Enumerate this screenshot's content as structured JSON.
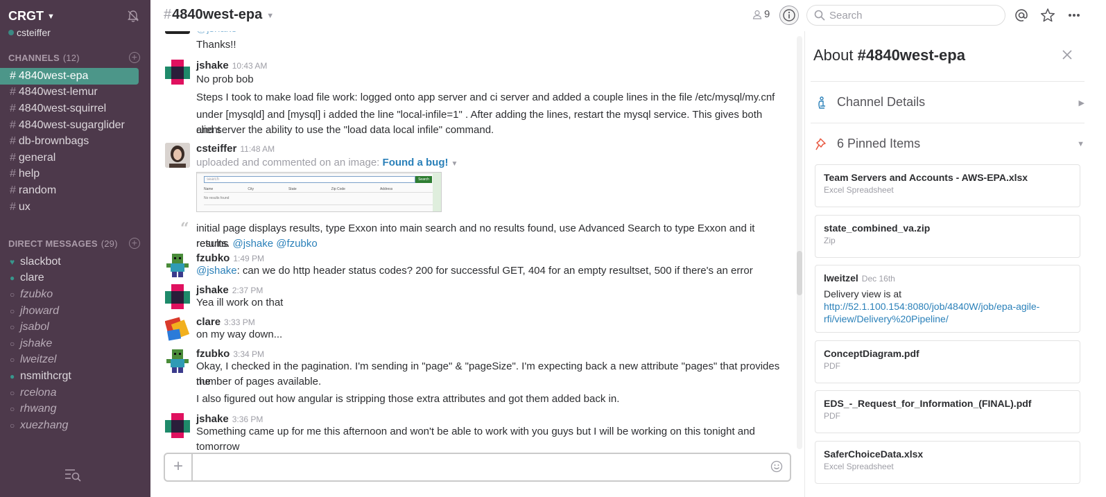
{
  "team": {
    "name": "CRGT",
    "user": "csteiffer"
  },
  "sidebar": {
    "channels_header": "CHANNELS",
    "channels_count": "(12)",
    "channels": [
      {
        "name": "4840west-epa"
      },
      {
        "name": "4840west-lemur"
      },
      {
        "name": "4840west-squirrel"
      },
      {
        "name": "4840west-sugarglider"
      },
      {
        "name": "db-brownbags"
      },
      {
        "name": "general"
      },
      {
        "name": "help"
      },
      {
        "name": "random"
      },
      {
        "name": "ux"
      }
    ],
    "dm_header": "DIRECT MESSAGES",
    "dm_count": "(29)",
    "dms": [
      {
        "name": "slackbot",
        "status": "heart"
      },
      {
        "name": "clare",
        "status": "online"
      },
      {
        "name": "fzubko",
        "status": "offline"
      },
      {
        "name": "jhoward",
        "status": "offline"
      },
      {
        "name": "jsabol",
        "status": "offline"
      },
      {
        "name": "jshake",
        "status": "offline"
      },
      {
        "name": "lweitzel",
        "status": "offline"
      },
      {
        "name": "nsmithcrgt",
        "status": "online"
      },
      {
        "name": "rcelona",
        "status": "offline"
      },
      {
        "name": "rhwang",
        "status": "offline"
      },
      {
        "name": "xuezhang",
        "status": "offline"
      }
    ]
  },
  "header": {
    "hash": "#",
    "channel": "4840west-epa",
    "members": "9",
    "search_placeholder": "Search"
  },
  "messages": {
    "m0": {
      "partial": "@jshake",
      "text": "Thanks!!"
    },
    "m1": {
      "sender": "jshake",
      "time": "10:43 AM",
      "line1": "No prob  bob",
      "line2": "Steps  I took to make load file work: logged onto app server and ci server and added a couple lines in the file /etc/mysql/my.cnf",
      "line3": "under [mysqld] and [mysql] i added the line  \"local-infile=1\" .  After  adding the lines, restart the mysql service. This gives both client",
      "line4": "and server the ability to use the \"load data local infile\" command."
    },
    "m2": {
      "sender": "csteiffer",
      "time": "11:48 AM",
      "upload_text": "uploaded and commented on an image: ",
      "upload_link": "Found a bug!",
      "comment1": "initial page displays results, type Exxon into main search and no results found, use Advanced Search to type Exxon and it returns",
      "comment2": "results.",
      "comment_mentions": "@jshake @fzubko"
    },
    "m3": {
      "sender": "fzubko",
      "time": "1:49 PM",
      "mention": "@jshake",
      "text": ": can we do http header status codes?  200 for successful GET, 404 for an empty resultset, 500 if there's an error"
    },
    "m4": {
      "sender": "jshake",
      "time": "2:37 PM",
      "text": "Yea ill work on that"
    },
    "m5": {
      "sender": "clare",
      "time": "3:33 PM",
      "text": "on my way down..."
    },
    "m6": {
      "sender": "fzubko",
      "time": "3:34 PM",
      "line1": "Okay, I checked in the pagination.  I'm sending in \"page\" & \"pageSize\".  I'm expecting back a new attribute \"pages\" that provides the",
      "line2": "number of pages available.",
      "line3": "I also figured out how angular is stripping those extra attributes and got them added back in."
    },
    "m7": {
      "sender": "jshake",
      "time": "3:36 PM",
      "line1": "Something came up for me this afternoon and won't be able to work with you guys but I will be working on this tonight and",
      "line2": "tomorrow"
    }
  },
  "thumbnail": {
    "search_text": "search",
    "cols": [
      "Name",
      "City",
      "State",
      "Zip Code",
      "Address"
    ],
    "empty": "No results found",
    "button": "Search"
  },
  "panel": {
    "about": "About",
    "channel": "#4840west-epa",
    "details_label": "Channel Details",
    "pinned_label": "6 Pinned Items",
    "pins": [
      {
        "title": "Team Servers and Accounts - AWS-EPA.xlsx",
        "sub": "Excel Spreadsheet"
      },
      {
        "title": "state_combined_va.zip",
        "sub": "Zip"
      },
      {
        "author": "lweitzel",
        "date": "Dec 16th",
        "body": "Delivery view is at",
        "link1": "http://52.1.100.154:8080/job/4840W/job/epa-agile-",
        "link2": "rfi/view/Delivery%20Pipeline/"
      },
      {
        "title": "ConceptDiagram.pdf",
        "sub": "PDF"
      },
      {
        "title": "EDS_-_Request_for_Information_(FINAL).pdf",
        "sub": "PDF"
      },
      {
        "title": "SaferChoiceData.xlsx",
        "sub": "Excel Spreadsheet"
      }
    ]
  },
  "colors": {
    "sidebar": "#4d394b",
    "active_channel": "#4c9689",
    "link": "#2a80b9",
    "presence": "#38978d"
  }
}
